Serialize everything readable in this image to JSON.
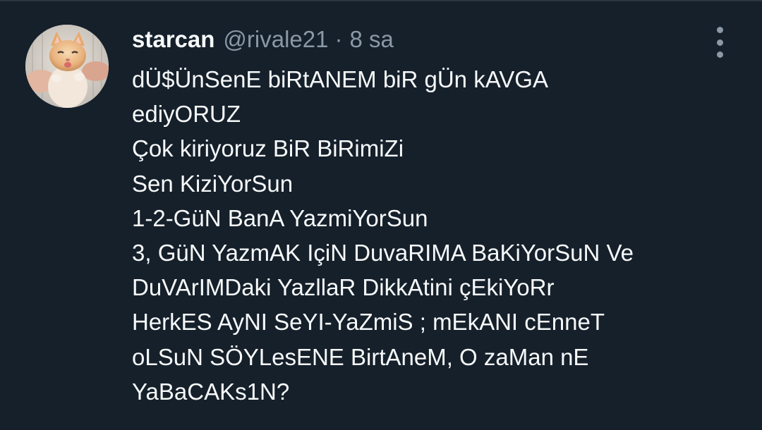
{
  "tweet": {
    "author": {
      "display_name": "starcan",
      "handle": "@rivale21",
      "avatar": "kitten-photo"
    },
    "separator": "·",
    "timestamp": "8 sa",
    "menu_icon": "more-vertical-icon",
    "text_lines": [
      "dÜ$ÜnSenE biRtANEM biR gÜn kAVGA",
      "ediyORUZ",
      "Çok kiriyoruz BiR BiRimiZi",
      "Sen KiziYorSun",
      "1-2-GüN BanA YazmiYorSun",
      "3, GüN YazmAK IçiN DuvaRIMA BaKiYorSuN Ve",
      "DuVArIMDaki YazllaR DikkAtini çEkiYoRr",
      "HerkES AyNI SeYI-YaZmiS ; mEkANI cEnneT",
      "oLSuN SÖYLesENE BirtAneM, O zaMan nE",
      "YaBaCAKs1N?"
    ]
  },
  "colors": {
    "background": "#15202b",
    "primary_text": "#f7f9f9",
    "secondary_text": "#8b98a5"
  }
}
